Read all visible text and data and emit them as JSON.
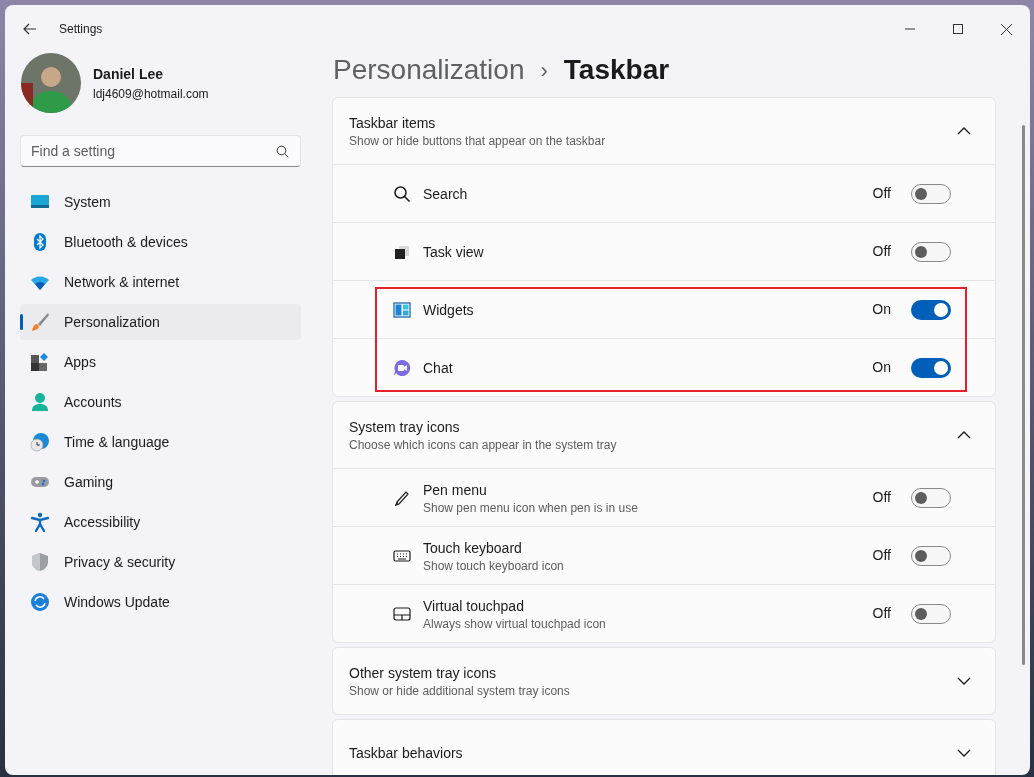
{
  "window": {
    "title": "Settings"
  },
  "profile": {
    "name": "Daniel Lee",
    "email": "ldj4609@hotmail.com"
  },
  "search": {
    "placeholder": "Find a setting"
  },
  "sidebar": {
    "items": [
      {
        "label": "System",
        "kind": "system",
        "selected": false
      },
      {
        "label": "Bluetooth & devices",
        "kind": "bluetooth",
        "selected": false
      },
      {
        "label": "Network & internet",
        "kind": "wifi",
        "selected": false
      },
      {
        "label": "Personalization",
        "kind": "brush",
        "selected": true
      },
      {
        "label": "Apps",
        "kind": "apps",
        "selected": false
      },
      {
        "label": "Accounts",
        "kind": "person",
        "selected": false
      },
      {
        "label": "Time & language",
        "kind": "globe",
        "selected": false
      },
      {
        "label": "Gaming",
        "kind": "gamepad",
        "selected": false
      },
      {
        "label": "Accessibility",
        "kind": "accessibility",
        "selected": false
      },
      {
        "label": "Privacy & security",
        "kind": "shield",
        "selected": false
      },
      {
        "label": "Windows Update",
        "kind": "update",
        "selected": false
      }
    ]
  },
  "breadcrumb": {
    "parent": "Personalization",
    "separator": "›",
    "current": "Taskbar"
  },
  "sections": [
    {
      "title": "Taskbar items",
      "subtitle": "Show or hide buttons that appear on the taskbar",
      "expanded": true,
      "items": [
        {
          "label": "Search",
          "kind": "search",
          "state": "Off",
          "on": false,
          "highlighted": false
        },
        {
          "label": "Task view",
          "kind": "taskview",
          "state": "Off",
          "on": false,
          "highlighted": false
        },
        {
          "label": "Widgets",
          "kind": "widgets",
          "state": "On",
          "on": true,
          "highlighted": true
        },
        {
          "label": "Chat",
          "kind": "chat",
          "state": "On",
          "on": true,
          "highlighted": true
        }
      ]
    },
    {
      "title": "System tray icons",
      "subtitle": "Choose which icons can appear in the system tray",
      "expanded": true,
      "items": [
        {
          "label": "Pen menu",
          "description": "Show pen menu icon when pen is in use",
          "kind": "pen",
          "state": "Off",
          "on": false,
          "highlighted": false
        },
        {
          "label": "Touch keyboard",
          "description": "Show touch keyboard icon",
          "kind": "keyboard",
          "state": "Off",
          "on": false,
          "highlighted": false
        },
        {
          "label": "Virtual touchpad",
          "description": "Always show virtual touchpad icon",
          "kind": "touchpad",
          "state": "Off",
          "on": false,
          "highlighted": false
        }
      ]
    },
    {
      "title": "Other system tray icons",
      "subtitle": "Show or hide additional system tray icons",
      "expanded": false
    },
    {
      "title": "Taskbar behaviors",
      "expanded": false
    }
  ]
}
